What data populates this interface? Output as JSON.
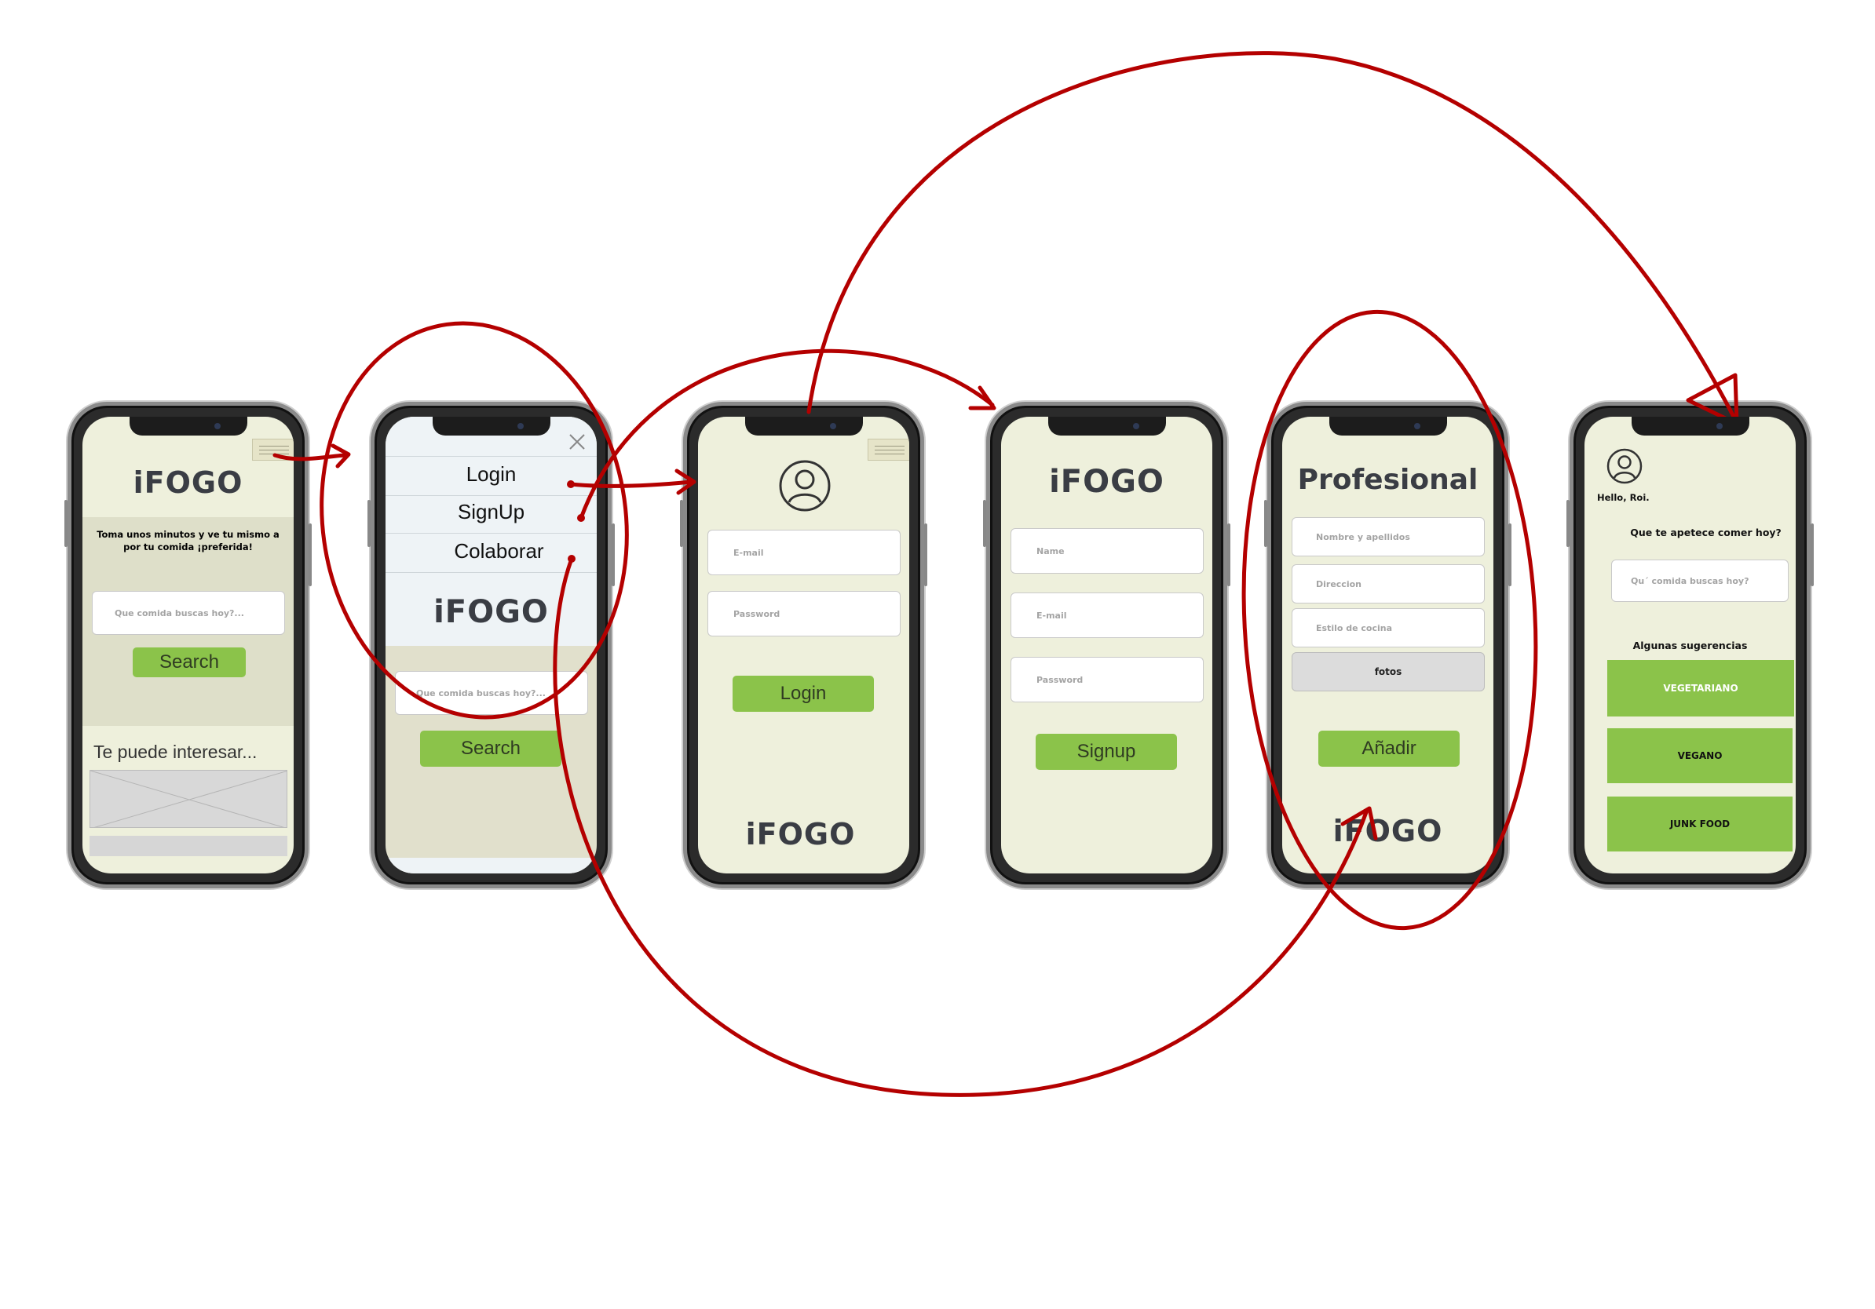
{
  "colors": {
    "screen_bg": "#eef0dc",
    "band_bg": "#dedfc9",
    "menu_bg": "#eef3f6",
    "button_green": "#8bc34a",
    "arrow_red": "#b40000",
    "logo_text": "#3a3d44"
  },
  "screen1": {
    "logo": "iFOGO",
    "tagline": "Toma unos minutos y ve tu mismo a por tu comida ¡preferida!",
    "search_placeholder": "Que comida buscas hoy?...",
    "search_button": "Search",
    "section_title": "Te puede interesar...",
    "menu_icon": "hamburger-icon"
  },
  "screen2": {
    "close_icon": "close-icon",
    "menu_items": [
      "Login",
      "SignUp",
      "Colaborar"
    ],
    "logo": "iFOGO",
    "search_placeholder": "Que comida buscas hoy?...",
    "search_button": "Search"
  },
  "screen3": {
    "avatar_icon": "user-avatar-icon",
    "email_placeholder": "E-mail",
    "password_placeholder": "Password",
    "login_button": "Login",
    "logo": "iFOGO"
  },
  "screen4": {
    "logo": "iFOGO",
    "name_placeholder": "Name",
    "email_placeholder": "E-mail",
    "password_placeholder": "Password",
    "signup_button": "Signup"
  },
  "screen5": {
    "title": "Profesional",
    "name_placeholder": "Nombre y apellidos",
    "address_placeholder": "Direccion",
    "style_placeholder": "Estilo de cocina",
    "photos_label": "fotos",
    "add_button": "Añadir",
    "logo": "iFOGO"
  },
  "screen6": {
    "avatar_icon": "user-avatar-icon",
    "greeting": "Hello, Roi.",
    "question": "Que te apetece comer hoy?",
    "search_placeholder": "Qu´ comida buscas hoy?",
    "suggestions_title": "Algunas sugerencias",
    "suggestions": [
      "VEGETARIANO",
      "VEGANO",
      "JUNK FOOD"
    ]
  }
}
